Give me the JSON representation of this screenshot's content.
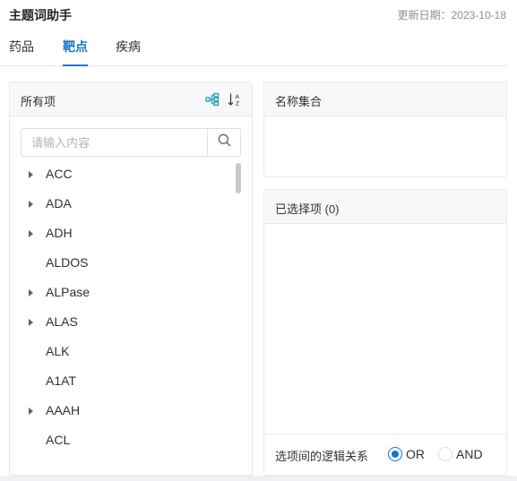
{
  "header": {
    "title": "主题词助手",
    "updated": "更新日期：2023-10-18"
  },
  "tabs": [
    {
      "label": "药品",
      "active": false
    },
    {
      "label": "靶点",
      "active": true
    },
    {
      "label": "疾病",
      "active": false
    }
  ],
  "left_panel": {
    "title": "所有项",
    "icons": [
      "tree-structure-icon",
      "sort-alpha-icon"
    ],
    "search": {
      "placeholder": "请输入内容",
      "value": "",
      "icon": "search-icon"
    },
    "items": [
      {
        "label": "ACC",
        "expandable": true
      },
      {
        "label": "ADA",
        "expandable": true
      },
      {
        "label": "ADH",
        "expandable": true
      },
      {
        "label": "ALDOS",
        "expandable": false
      },
      {
        "label": "ALPase",
        "expandable": true
      },
      {
        "label": "ALAS",
        "expandable": true
      },
      {
        "label": "ALK",
        "expandable": false
      },
      {
        "label": "A1AT",
        "expandable": false
      },
      {
        "label": "AAAH",
        "expandable": true
      },
      {
        "label": "ACL",
        "expandable": false
      }
    ]
  },
  "names_panel": {
    "title": "名称集合"
  },
  "selected_panel": {
    "title": "已选择项 (0)",
    "logic_label": "选项间的逻辑关系",
    "options": [
      {
        "label": "OR",
        "checked": true
      },
      {
        "label": "AND",
        "checked": false
      }
    ]
  },
  "colors": {
    "accent": "#1677c9",
    "panel_header": "#f7f8fa",
    "border": "#e6e8eb"
  }
}
